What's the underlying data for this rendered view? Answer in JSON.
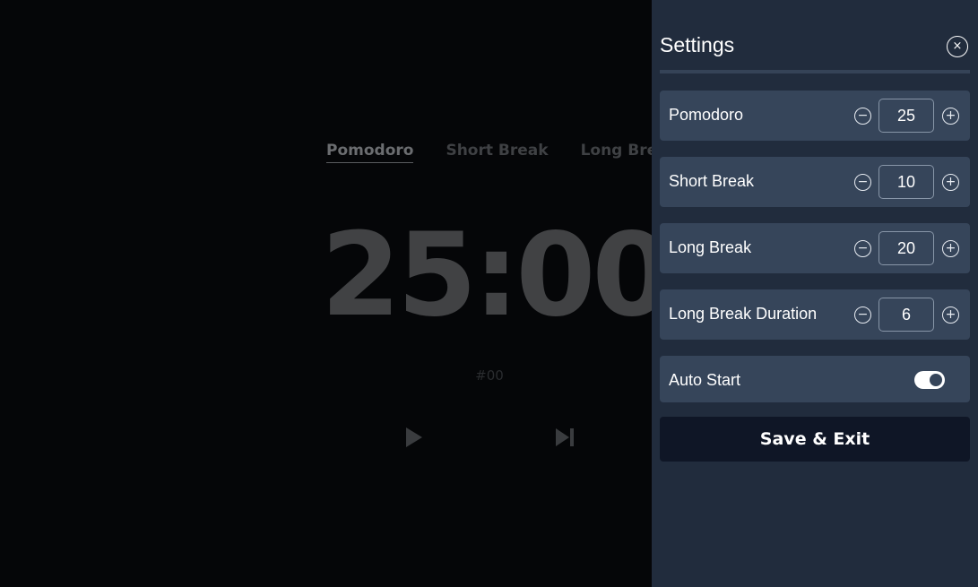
{
  "timer": {
    "tabs": [
      {
        "label": "Pomodoro",
        "active": true
      },
      {
        "label": "Short Break",
        "active": false
      },
      {
        "label": "Long Break",
        "active": false
      }
    ],
    "time": "25:00",
    "session": "#00",
    "controls": {
      "play_icon": "play-icon",
      "skip_icon": "skip-next-icon"
    }
  },
  "settings": {
    "title": "Settings",
    "close_icon": "close-icon",
    "close_glyph": "×",
    "decrement_glyph": "−",
    "increment_glyph": "+",
    "items": [
      {
        "label": "Pomodoro",
        "value": "25"
      },
      {
        "label": "Short Break",
        "value": "10"
      },
      {
        "label": "Long Break",
        "value": "20"
      },
      {
        "label": "Long Break Duration",
        "value": "6"
      }
    ],
    "auto_start": {
      "label": "Auto Start",
      "enabled": true
    },
    "save_label": "Save & Exit"
  },
  "colors": {
    "background": "#050608",
    "panel": "#212c3d",
    "row": "#36455a",
    "save_button": "#0f1626",
    "text": "#ffffff"
  }
}
